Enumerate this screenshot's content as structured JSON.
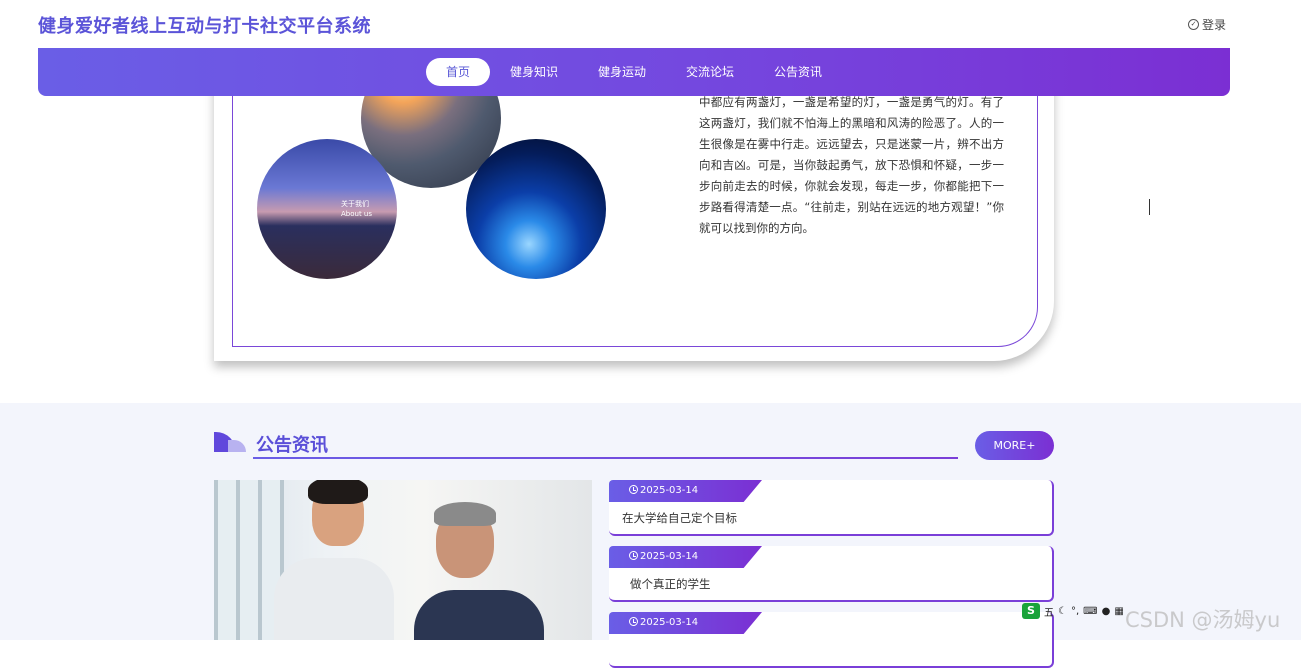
{
  "header": {
    "site_title": "健身爱好者线上互动与打卡社交平台系统",
    "login_label": "登录"
  },
  "nav": {
    "items": [
      {
        "label": "首页",
        "active": true
      },
      {
        "label": "健身知识",
        "active": false
      },
      {
        "label": "健身运动",
        "active": false
      },
      {
        "label": "交流论坛",
        "active": false
      },
      {
        "label": "公告资讯",
        "active": false
      }
    ]
  },
  "about": {
    "circle_caption_line1": "关于我们",
    "circle_caption_line2": "About us",
    "paragraph": "看，是否真的如此。如果你有信心，你对前途就不犹豫了。如果你有勇气，你就不怕前途是否有困难或危险了每个人心中都应有两盏灯，一盏是希望的灯，一盏是勇气的灯。有了这两盏灯，我们就不怕海上的黑暗和风涛的险恶了。人的一生很像是在雾中行走。远远望去，只是迷蒙一片，辨不出方向和吉凶。可是，当你鼓起勇气，放下恐惧和怀疑，一步一步向前走去的时候，你就会发现，每走一步，你都能把下一步路看得清楚一点。“往前走，别站在远远的地方观望！”你就可以找到你的方向。"
  },
  "news": {
    "title": "公告资讯",
    "more_label": "MORE+",
    "items": [
      {
        "date": "2025-03-14",
        "title": "在大学给自己定个目标"
      },
      {
        "date": "2025-03-14",
        "title": "做个真正的学生"
      },
      {
        "date": "2025-03-14",
        "title": ""
      }
    ]
  },
  "overlay": {
    "ime_logo": "S",
    "ime_mode": "五",
    "watermark": "CSDN @汤姆yu"
  },
  "colors": {
    "brand": "#5b54d8",
    "nav_gradient_start": "#6a5ee6",
    "nav_gradient_end": "#7b2fd3",
    "section_bg": "#f3f5fc"
  }
}
